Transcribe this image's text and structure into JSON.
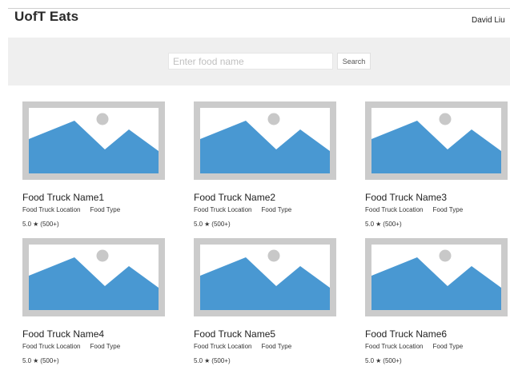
{
  "header": {
    "brand": "UofT Eats",
    "user_name": "David Liu"
  },
  "search": {
    "placeholder": "Enter food name",
    "value": "",
    "button_label": "Search"
  },
  "cards": [
    {
      "name": "Food Truck Name1",
      "location": "Food Truck Location",
      "type": "Food Type",
      "rating": "5.0",
      "star": "★",
      "reviews": "(500+)",
      "image_icon": "image-placeholder-icon"
    },
    {
      "name": "Food Truck Name2",
      "location": "Food Truck Location",
      "type": "Food Type",
      "rating": "5.0",
      "star": "★",
      "reviews": "(500+)",
      "image_icon": "image-placeholder-icon"
    },
    {
      "name": "Food Truck Name3",
      "location": "Food Truck Location",
      "type": "Food Type",
      "rating": "5.0",
      "star": "★",
      "reviews": "(500+)",
      "image_icon": "image-placeholder-icon"
    },
    {
      "name": "Food Truck Name4",
      "location": "Food Truck Location",
      "type": "Food Type",
      "rating": "5.0",
      "star": "★",
      "reviews": "(500+)",
      "image_icon": "image-placeholder-icon"
    },
    {
      "name": "Food Truck Name5",
      "location": "Food Truck Location",
      "type": "Food Type",
      "rating": "5.0",
      "star": "★",
      "reviews": "(500+)",
      "image_icon": "image-placeholder-icon"
    },
    {
      "name": "Food Truck Name6",
      "location": "Food Truck Location",
      "type": "Food Type",
      "rating": "5.0",
      "star": "★",
      "reviews": "(500+)",
      "image_icon": "image-placeholder-icon"
    }
  ],
  "colors": {
    "header_bg": "#ffffff",
    "search_bar_bg": "#efefef",
    "image_frame": "#cbcbcb",
    "mountain": "#4998d2",
    "sun": "#c8c8c8"
  }
}
